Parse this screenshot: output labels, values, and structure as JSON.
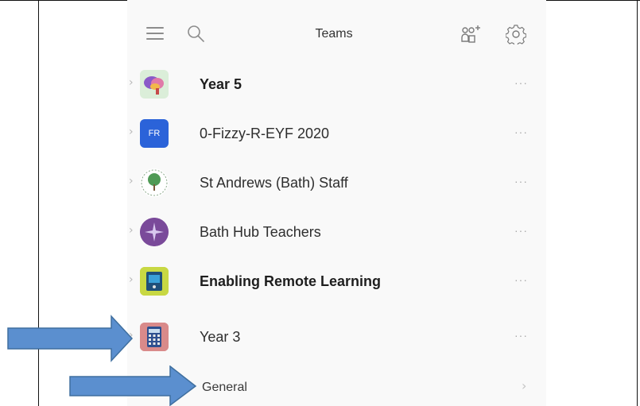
{
  "header": {
    "title": "Teams",
    "icons": [
      "hamburger-menu-icon",
      "search-icon",
      "join-create-team-icon",
      "settings-gear-icon"
    ]
  },
  "teams": [
    {
      "name": "Year 5",
      "bold": true,
      "avatar": "brain-image"
    },
    {
      "name": "0-Fizzy-R-EYF 2020",
      "bold": false,
      "avatar": "initials",
      "initials": "FR",
      "color": "#2b63d9"
    },
    {
      "name": "St Andrews (Bath) Staff",
      "bold": false,
      "avatar": "tree-logo"
    },
    {
      "name": "Bath Hub Teachers",
      "bold": false,
      "avatar": "purple-star"
    },
    {
      "name": "Enabling Remote Learning",
      "bold": true,
      "avatar": "laptop-image"
    },
    {
      "name": "Year 3",
      "bold": false,
      "avatar": "calculator-image"
    }
  ],
  "row_labels": {
    "more": "···",
    "chevron": "›"
  },
  "channel": {
    "name": "General"
  },
  "colors": {
    "arrow_fill": "#5b8fcf",
    "arrow_stroke": "#3f6f9f",
    "text": "#2e2e2e",
    "muted": "#a8a8a8",
    "background": "#f9f9f9"
  }
}
